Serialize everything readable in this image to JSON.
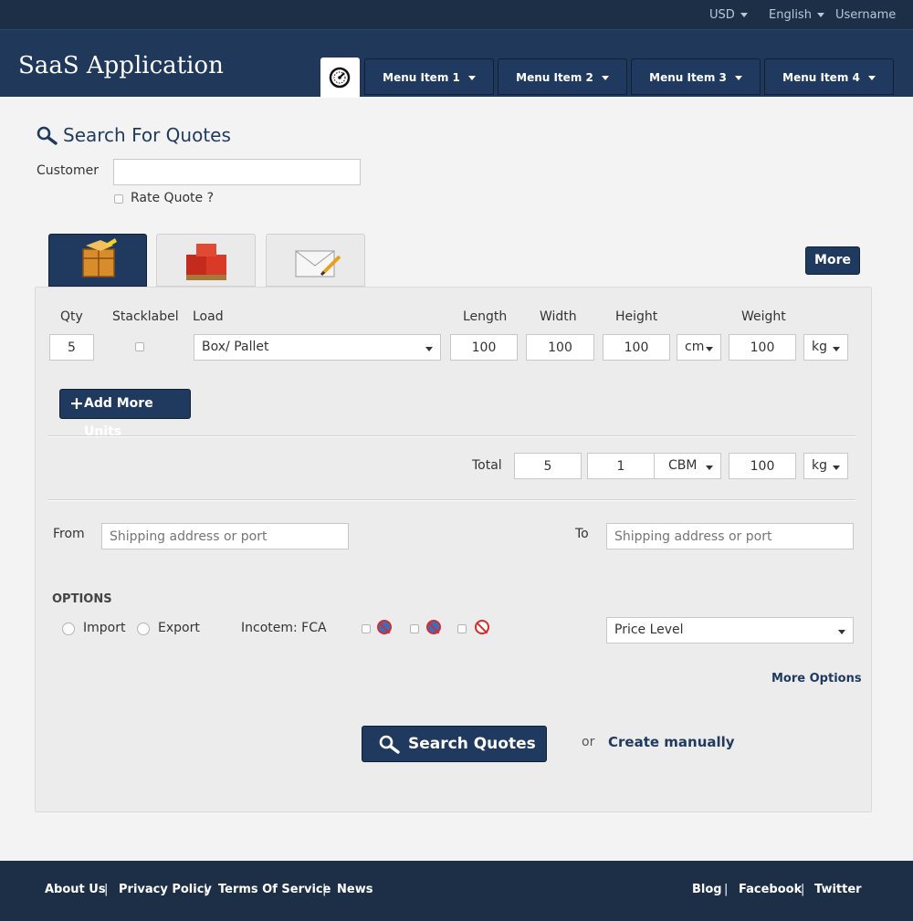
{
  "topbar": {
    "currency": "USD",
    "language": "English",
    "username": "Username"
  },
  "header": {
    "app_title": "SaaS Application",
    "menu": [
      {
        "label": "Menu Item 1"
      },
      {
        "label": "Menu Item 2"
      },
      {
        "label": "Menu Item 3"
      },
      {
        "label": "Menu Item 4"
      }
    ]
  },
  "search": {
    "title": "Search For Quotes",
    "customer_label": "Customer",
    "customer_value": "",
    "rate_quote_label": "Rate Quote ?"
  },
  "tabs": {
    "more_label": "More",
    "icons": [
      "crate-icon",
      "pallet-icon",
      "envelope-icon"
    ]
  },
  "units": {
    "headers": {
      "qty": "Qty",
      "stackable": "Stacklabel",
      "load": "Load",
      "length": "Length",
      "width": "Width",
      "height": "Height",
      "weight": "Weight"
    },
    "row": {
      "qty": "5",
      "load": "Box/ Pallet",
      "length": "100",
      "width": "100",
      "height": "100",
      "dim_unit": "cm",
      "weight": "100",
      "weight_unit": "kg"
    },
    "add_more_label": "Add More Units"
  },
  "totals": {
    "label": "Total",
    "qty": "5",
    "volume": "1",
    "volume_unit": "CBM",
    "weight": "100",
    "weight_unit": "kg"
  },
  "route": {
    "from_label": "From",
    "from_placeholder": "Shipping address or port",
    "to_label": "To",
    "to_placeholder": "Shipping address or port"
  },
  "options": {
    "heading": "OPTIONS",
    "import_label": "Import",
    "export_label": "Export",
    "incoterm_label": "Incotem: FCA",
    "price_level": "Price Level",
    "more_options_label": "More Options"
  },
  "actions": {
    "search_label": "Search Quotes",
    "or_label": "or",
    "create_manually_label": "Create manually"
  },
  "footer": {
    "left_links": [
      "About Us",
      "Privacy Policy",
      "Terms Of Service",
      "News"
    ],
    "right_links": [
      "Blog",
      "Facebook",
      "Twitter"
    ]
  }
}
